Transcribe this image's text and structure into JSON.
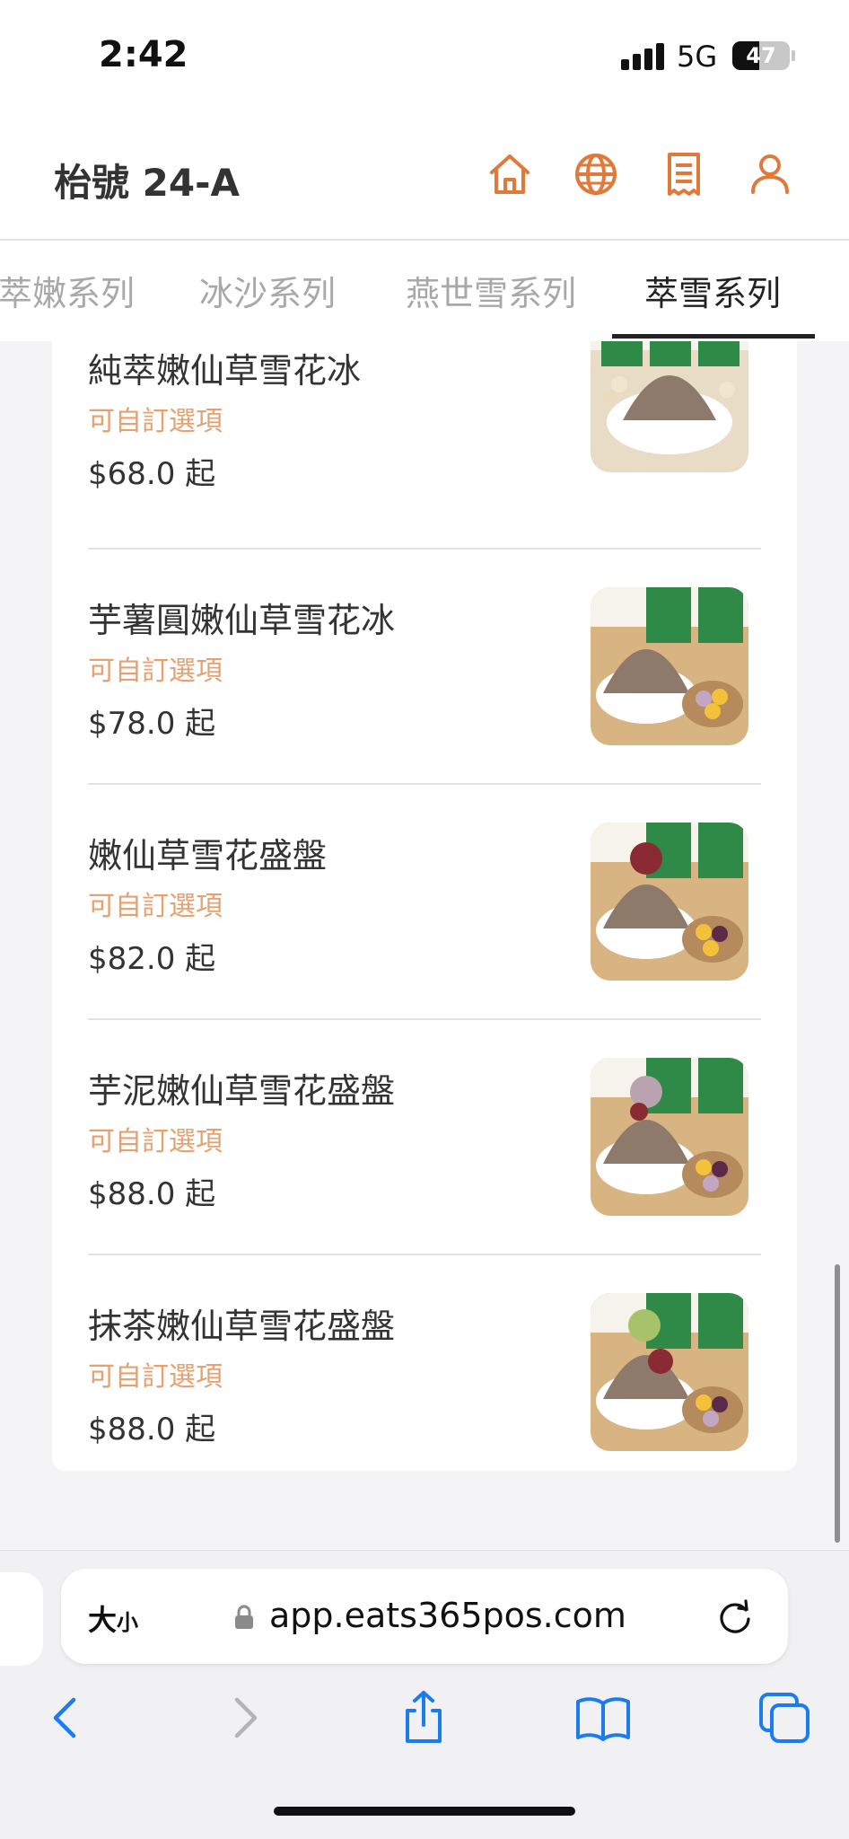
{
  "status_bar": {
    "time": "2:42",
    "network": "5G",
    "battery": "47",
    "battery_level_percent": 47
  },
  "header": {
    "table_label": "枱號 24-A",
    "icons": [
      "home-icon",
      "globe-icon",
      "receipt-icon",
      "user-icon"
    ],
    "accent_color": "#e07a3b"
  },
  "category_tabs": [
    {
      "label": "萃嫩系列",
      "active": false
    },
    {
      "label": "冰沙系列",
      "active": false
    },
    {
      "label": "燕世雪系列",
      "active": false
    },
    {
      "label": "萃雪系列",
      "active": true
    }
  ],
  "menu_items": [
    {
      "name": "純萃嫩仙草雪花冰",
      "option": "可自訂選項",
      "price": "$68.0 起"
    },
    {
      "name": "芋薯圓嫩仙草雪花冰",
      "option": "可自訂選項",
      "price": "$78.0 起"
    },
    {
      "name": "嫩仙草雪花盛盤",
      "option": "可自訂選項",
      "price": "$82.0 起"
    },
    {
      "name": "芋泥嫩仙草雪花盛盤",
      "option": "可自訂選項",
      "price": "$88.0 起"
    },
    {
      "name": "抹茶嫩仙草雪花盛盤",
      "option": "可自訂選項",
      "price": "$88.0 起"
    }
  ],
  "browser": {
    "text_size_label_big": "大",
    "text_size_label_small": "小",
    "url": "app.eats365pos.com",
    "nav_icons": [
      "back-icon",
      "forward-icon",
      "share-icon",
      "bookmarks-icon",
      "tabs-icon"
    ],
    "accent_color": "#1a7cf0"
  }
}
